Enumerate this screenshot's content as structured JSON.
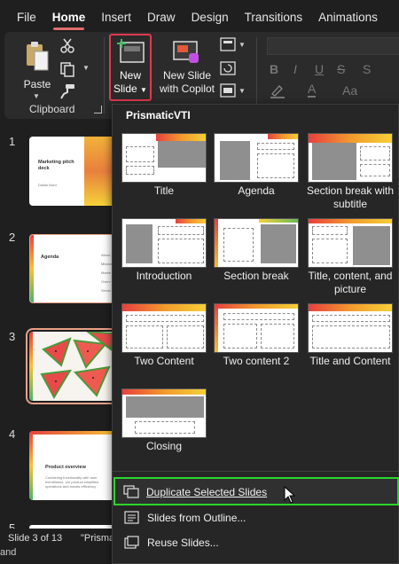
{
  "tabs": [
    "File",
    "Home",
    "Insert",
    "Draw",
    "Design",
    "Transitions",
    "Animations"
  ],
  "active_tab": "Home",
  "ribbon": {
    "paste_label": "Paste",
    "new_slide_label_1": "New",
    "new_slide_label_2": "Slide",
    "copilot_label_1": "New Slide",
    "copilot_label_2": "with Copilot",
    "clipboard_group": "Clipboard",
    "format": {
      "bold": "B",
      "italic": "I",
      "underline": "U",
      "strike": "S",
      "aa": "Aa"
    }
  },
  "slides_panel": {
    "slides": [
      {
        "number": "1",
        "title": "Marketing pitch deck",
        "subtitle": "Dallas Ilsed"
      },
      {
        "number": "2",
        "title": "Agenda",
        "lines": [
          "About",
          "Mission",
          "Marke",
          "Overv",
          "Servic"
        ]
      },
      {
        "number": "3",
        "title": ""
      },
      {
        "number": "4",
        "title": "Product overview",
        "body": "Combining functionality with user friendliness, our product simplifies operations and boosts efficiency"
      },
      {
        "number": "5"
      }
    ],
    "selected_index": 2
  },
  "status": {
    "slide_info": "Slide 3 of 13",
    "theme": "\"Prisma",
    "notes": "and"
  },
  "new_slide_menu": {
    "theme_name": "PrismaticVTI",
    "layouts": [
      {
        "name": "Title"
      },
      {
        "name": "Agenda"
      },
      {
        "name": "Section break with subtitle"
      },
      {
        "name": "Introduction"
      },
      {
        "name": "Section break"
      },
      {
        "name": "Title, content, and picture"
      },
      {
        "name": "Two Content"
      },
      {
        "name": "Two content 2"
      },
      {
        "name": "Title and Content"
      },
      {
        "name": "Closing"
      }
    ],
    "items": [
      {
        "label": "Duplicate Selected Slides",
        "icon": "duplicate-slides-icon",
        "highlighted": true
      },
      {
        "label": "Slides from Outline...",
        "icon": "outline-icon"
      },
      {
        "label": "Reuse Slides...",
        "icon": "reuse-slides-icon"
      }
    ]
  },
  "colors": {
    "accent_tab": "#e06c6c",
    "new_slide_outline": "#e03a4e",
    "highlight_outline": "#2ad62a",
    "background": "#1f1f1f"
  }
}
